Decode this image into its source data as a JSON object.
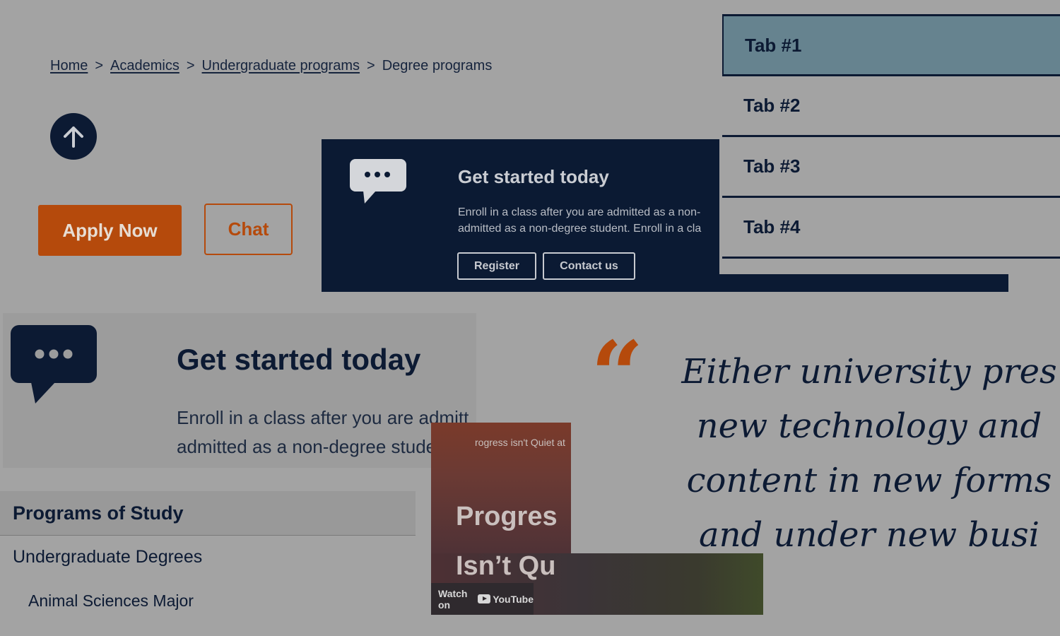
{
  "breadcrumb": {
    "items": [
      "Home",
      "Academics",
      "Undergraduate programs"
    ],
    "current": "Degree programs",
    "separator": ">"
  },
  "actions": {
    "apply_label": "Apply Now",
    "chat_label": "Chat"
  },
  "dark_banner": {
    "title": "Get started today",
    "body_line1": "Enroll in a class after you are admitted as a non-",
    "body_line2": "admitted as a non-degree student. Enroll in a cla",
    "register_label": "Register",
    "contact_label": "Contact us"
  },
  "tabs": [
    "Tab #1",
    "Tab #2",
    "Tab #3",
    "Tab #4"
  ],
  "light_box": {
    "title": "Get started today",
    "body_line1": "Enroll in a class after you are admitt",
    "body_line2": "admitted as a non-degree student. E"
  },
  "quote": {
    "lines": [
      "Either university pres",
      "new technology and",
      "content in new forms",
      "and under new busi"
    ]
  },
  "sidenav": {
    "header": "Programs of Study",
    "item1": "Undergraduate Degrees",
    "item2": "Animal Sciences Major"
  },
  "video": {
    "title": "rogress isn't Quiet at",
    "headline_line1": "Progres",
    "headline_line2": "Isn’t Qu",
    "watch_label": "Watch on",
    "platform": "YouTube"
  },
  "colors": {
    "navy": "#0c1a33",
    "orange": "#b54a0c",
    "active_tab": "#66838f"
  }
}
